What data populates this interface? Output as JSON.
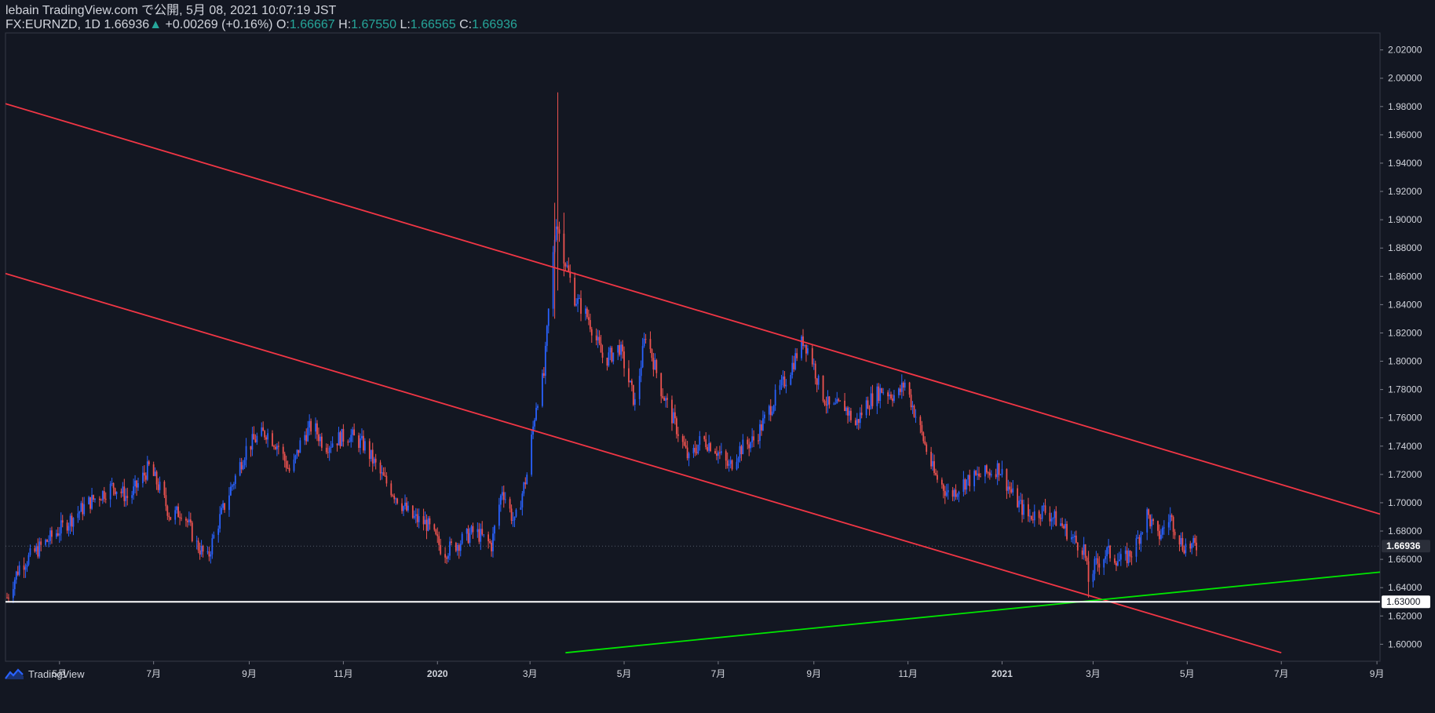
{
  "header": {
    "line1": "lebain TradingView.com で公開, 5月 08, 2021 10:07:19 JST",
    "symbol": "FX:EURNZD, 1D",
    "last": "1.66936",
    "change_arrow": "▲",
    "change": "+0.00269 (+0.16%)",
    "o_label": "O:",
    "o_val": "1.66667",
    "h_label": "H:",
    "h_val": "1.67550",
    "l_label": "L:",
    "l_val": "1.66565",
    "c_label": "C:",
    "c_val": "1.66936"
  },
  "footer": {
    "brand": "TradingView"
  },
  "colors": {
    "background": "#131722",
    "grid": "#1e222d",
    "axis_text": "#d1d4dc",
    "bull": "#2962ff",
    "bear": "#ef5350",
    "trend_red": "#f23645",
    "trend_green": "#00e600",
    "support": "#ffffff"
  },
  "chart_data": {
    "type": "candlestick",
    "title": "FX:EURNZD, 1D",
    "ylim": [
      1.588,
      2.032
    ],
    "y_ticks": [
      "2.02000",
      "2.00000",
      "1.98000",
      "1.96000",
      "1.94000",
      "1.92000",
      "1.90000",
      "1.88000",
      "1.86000",
      "1.84000",
      "1.82000",
      "1.80000",
      "1.78000",
      "1.76000",
      "1.74000",
      "1.72000",
      "1.70000",
      "1.68000",
      "1.66000",
      "1.64000",
      "1.62000",
      "1.60000"
    ],
    "x_ticks": [
      "5月",
      "7月",
      "9月",
      "11月",
      "2020",
      "3月",
      "5月",
      "7月",
      "9月",
      "11月",
      "2021",
      "3月",
      "5月",
      "7月",
      "9月"
    ],
    "x_tick_dates": [
      "2019-05-01",
      "2019-07-01",
      "2019-09-01",
      "2019-11-01",
      "2020-01-01",
      "2020-03-01",
      "2020-05-01",
      "2020-07-01",
      "2020-09-01",
      "2020-11-01",
      "2021-01-01",
      "2021-03-01",
      "2021-05-01",
      "2021-07-01",
      "2021-09-01"
    ],
    "xlim": [
      "2019-03-27",
      "2021-09-03"
    ],
    "last_price": {
      "label": "1.66936",
      "value": 1.66936
    },
    "support_level": {
      "label": "1.63000",
      "value": 1.63
    },
    "price_path": [
      [
        "2019-03-28",
        1.633
      ],
      [
        "2019-04-05",
        1.655
      ],
      [
        "2019-04-20",
        1.67
      ],
      [
        "2019-05-05",
        1.685
      ],
      [
        "2019-05-20",
        1.7
      ],
      [
        "2019-06-05",
        1.712
      ],
      [
        "2019-06-15",
        1.703
      ],
      [
        "2019-06-28",
        1.725
      ],
      [
        "2019-07-05",
        1.71
      ],
      [
        "2019-07-12",
        1.69
      ],
      [
        "2019-07-20",
        1.695
      ],
      [
        "2019-07-28",
        1.672
      ],
      [
        "2019-08-05",
        1.66
      ],
      [
        "2019-08-10",
        1.68
      ],
      [
        "2019-08-20",
        1.71
      ],
      [
        "2019-08-30",
        1.738
      ],
      [
        "2019-09-05",
        1.745
      ],
      [
        "2019-09-12",
        1.75
      ],
      [
        "2019-09-20",
        1.74
      ],
      [
        "2019-09-28",
        1.72
      ],
      [
        "2019-10-05",
        1.745
      ],
      [
        "2019-10-12",
        1.755
      ],
      [
        "2019-10-20",
        1.74
      ],
      [
        "2019-10-28",
        1.745
      ],
      [
        "2019-11-05",
        1.748
      ],
      [
        "2019-11-15",
        1.74
      ],
      [
        "2019-11-25",
        1.72
      ],
      [
        "2019-12-05",
        1.705
      ],
      [
        "2019-12-15",
        1.69
      ],
      [
        "2019-12-25",
        1.685
      ],
      [
        "2020-01-05",
        1.665
      ],
      [
        "2020-01-15",
        1.672
      ],
      [
        "2020-01-25",
        1.68
      ],
      [
        "2020-02-05",
        1.67
      ],
      [
        "2020-02-12",
        1.71
      ],
      [
        "2020-02-20",
        1.685
      ],
      [
        "2020-02-28",
        1.72
      ],
      [
        "2020-03-05",
        1.77
      ],
      [
        "2020-03-10",
        1.79
      ],
      [
        "2020-03-14",
        1.85
      ],
      [
        "2020-03-18",
        1.9
      ],
      [
        "2020-03-24",
        1.87
      ],
      [
        "2020-03-30",
        1.845
      ],
      [
        "2020-04-08",
        1.83
      ],
      [
        "2020-04-18",
        1.8
      ],
      [
        "2020-04-28",
        1.81
      ],
      [
        "2020-05-08",
        1.77
      ],
      [
        "2020-05-15",
        1.82
      ],
      [
        "2020-05-25",
        1.78
      ],
      [
        "2020-06-05",
        1.75
      ],
      [
        "2020-06-12",
        1.73
      ],
      [
        "2020-06-20",
        1.745
      ],
      [
        "2020-06-28",
        1.74
      ],
      [
        "2020-07-08",
        1.725
      ],
      [
        "2020-07-15",
        1.738
      ],
      [
        "2020-07-25",
        1.745
      ],
      [
        "2020-08-05",
        1.77
      ],
      [
        "2020-08-15",
        1.79
      ],
      [
        "2020-08-25",
        1.815
      ],
      [
        "2020-08-30",
        1.805
      ],
      [
        "2020-09-05",
        1.78
      ],
      [
        "2020-09-12",
        1.765
      ],
      [
        "2020-09-20",
        1.77
      ],
      [
        "2020-09-28",
        1.755
      ],
      [
        "2020-10-05",
        1.77
      ],
      [
        "2020-10-15",
        1.78
      ],
      [
        "2020-10-25",
        1.775
      ],
      [
        "2020-10-30",
        1.785
      ],
      [
        "2020-11-08",
        1.755
      ],
      [
        "2020-11-18",
        1.72
      ],
      [
        "2020-11-28",
        1.705
      ],
      [
        "2020-12-08",
        1.715
      ],
      [
        "2020-12-20",
        1.72
      ],
      [
        "2020-12-30",
        1.725
      ],
      [
        "2021-01-08",
        1.705
      ],
      [
        "2021-01-18",
        1.69
      ],
      [
        "2021-01-28",
        1.695
      ],
      [
        "2021-02-08",
        1.685
      ],
      [
        "2021-02-18",
        1.672
      ],
      [
        "2021-02-23",
        1.668
      ],
      [
        "2021-02-26",
        1.645
      ],
      [
        "2021-03-02",
        1.655
      ],
      [
        "2021-03-10",
        1.665
      ],
      [
        "2021-03-20",
        1.658
      ],
      [
        "2021-03-28",
        1.668
      ],
      [
        "2021-04-05",
        1.692
      ],
      [
        "2021-04-12",
        1.675
      ],
      [
        "2021-04-20",
        1.69
      ],
      [
        "2021-04-28",
        1.67
      ],
      [
        "2021-05-07",
        1.669
      ]
    ],
    "wick_highlights": [
      [
        "2020-03-19",
        1.99,
        1.85
      ],
      [
        "2020-03-17",
        1.912,
        1.83
      ],
      [
        "2020-03-23",
        1.905,
        1.86
      ],
      [
        "2021-02-26",
        1.666,
        1.633
      ]
    ],
    "trendlines": [
      {
        "color": "red",
        "from": [
          "2019-03-27",
          1.982
        ],
        "to": [
          "2021-09-03",
          1.692
        ]
      },
      {
        "color": "red",
        "from": [
          "2019-03-27",
          1.862
        ],
        "to": [
          "2021-07-01",
          1.594
        ]
      },
      {
        "color": "green",
        "from": [
          "2020-03-24",
          1.594
        ],
        "to": [
          "2021-09-03",
          1.651
        ]
      }
    ]
  }
}
